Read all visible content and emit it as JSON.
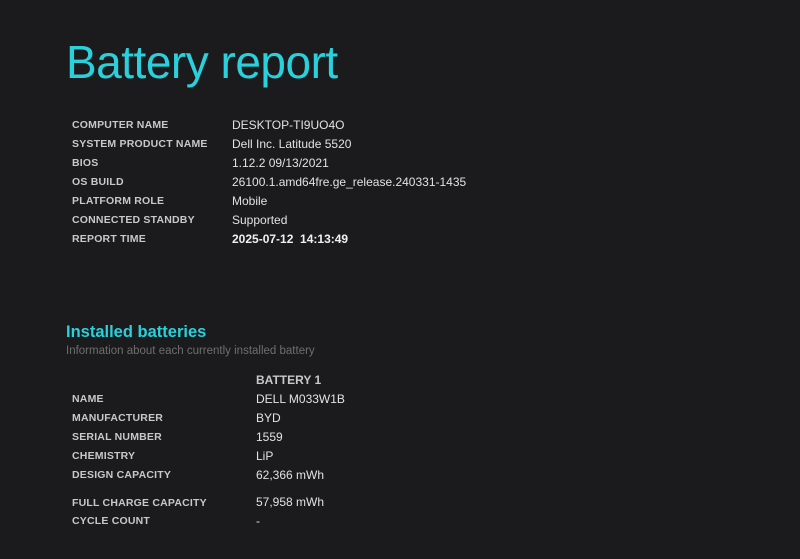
{
  "title": "Battery report",
  "system_info": [
    {
      "label": "COMPUTER NAME",
      "value": "DESKTOP-TI9UO4O"
    },
    {
      "label": "SYSTEM PRODUCT NAME",
      "value": "Dell Inc. Latitude 5520"
    },
    {
      "label": "BIOS",
      "value": "1.12.2 09/13/2021"
    },
    {
      "label": "OS BUILD",
      "value": "26100.1.amd64fre.ge_release.240331-1435"
    },
    {
      "label": "PLATFORM ROLE",
      "value": "Mobile"
    },
    {
      "label": "CONNECTED STANDBY",
      "value": "Supported"
    },
    {
      "label": "REPORT TIME",
      "value": "2025-07-12  14:13:49"
    }
  ],
  "installed_batteries": {
    "title": "Installed batteries",
    "subtitle": "Information about each currently installed battery",
    "column_header": "BATTERY 1",
    "rows": [
      {
        "label": "NAME",
        "value": "DELL M033W1B"
      },
      {
        "label": "MANUFACTURER",
        "value": "BYD"
      },
      {
        "label": "SERIAL NUMBER",
        "value": "1559"
      },
      {
        "label": "CHEMISTRY",
        "value": "LiP"
      },
      {
        "label": "DESIGN CAPACITY",
        "value": "62,366 mWh"
      },
      {
        "label": "FULL CHARGE CAPACITY",
        "value": "57,958 mWh"
      },
      {
        "label": "CYCLE COUNT",
        "value": "-"
      }
    ]
  },
  "colors": {
    "background": "#1b1b1d",
    "accent": "#2ad1dc",
    "text": "#e2e2e2",
    "muted": "#6e6e6e"
  }
}
